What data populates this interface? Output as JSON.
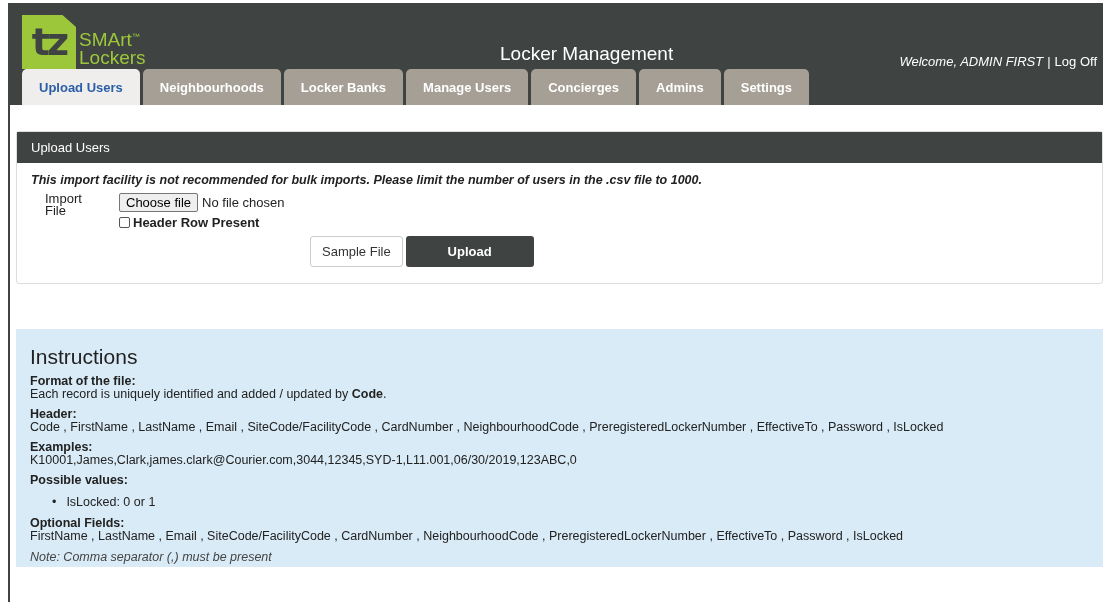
{
  "logo": {
    "mark": "tz",
    "line_1": "SMArt",
    "trademark": "™",
    "line_2": "Lockers"
  },
  "header": {
    "title": "Locker Management",
    "welcome": "Welcome, ADMIN FIRST",
    "separator": "|",
    "logout": "Log Off"
  },
  "tabs": [
    {
      "label": "Upload Users",
      "selected": true
    },
    {
      "label": "Neighbourhoods",
      "selected": false
    },
    {
      "label": "Locker Banks",
      "selected": false
    },
    {
      "label": "Manage Users",
      "selected": false
    },
    {
      "label": "Concierges",
      "selected": false
    },
    {
      "label": "Admins",
      "selected": false
    },
    {
      "label": "Settings",
      "selected": false
    }
  ],
  "upload_panel": {
    "title": "Upload Users",
    "warning": "This import facility is not recommended for bulk imports. Please limit the number of users in the .csv file to 1000.",
    "import_label": "Import File",
    "choose_button": "Choose file",
    "file_status": "No file chosen",
    "header_row": {
      "label": "Header Row Present",
      "checked": false
    },
    "sample_button": "Sample File",
    "upload_button": "Upload"
  },
  "instructions": {
    "title": "Instructions",
    "sections": [
      {
        "kind": "text",
        "heading": "Format of the file:",
        "text": "Each record is uniquely identified and added / updated by **Code**."
      },
      {
        "kind": "text",
        "heading": "Header:",
        "text": "Code , FirstName , LastName , Email , SiteCode/FacilityCode , CardNumber , NeighbourhoodCode , PreregisteredLockerNumber , EffectiveTo , Password , IsLocked"
      },
      {
        "kind": "text",
        "heading": "Examples:",
        "text": "K10001,James,Clark,james.clark@Courier.com,3044,12345,SYD-1,L11.001,06/30/2019,123ABC,0"
      },
      {
        "kind": "list",
        "heading": "Possible values:",
        "bullet": "•",
        "items": [
          "IsLocked: 0 or 1"
        ]
      },
      {
        "kind": "text",
        "heading": "Optional Fields:",
        "text": "FirstName , LastName , Email , SiteCode/FacilityCode , CardNumber , NeighbourhoodCode , PreregisteredLockerNumber , EffectiveTo , Password , IsLocked"
      }
    ],
    "note": "Note: Comma separator (,) must be present"
  }
}
